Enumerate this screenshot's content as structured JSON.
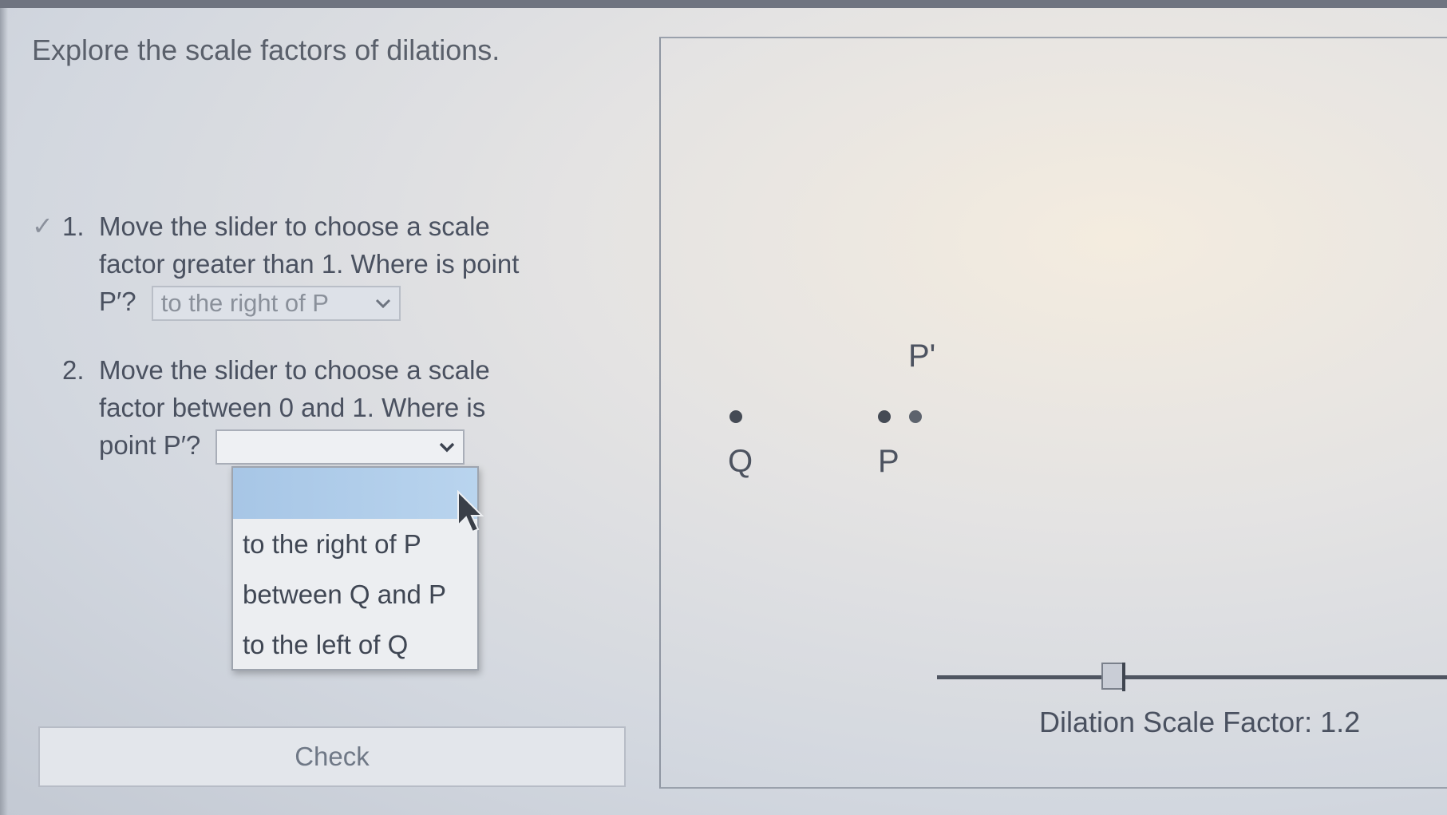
{
  "page": {
    "title": "Explore the scale factors of dilations."
  },
  "question1": {
    "number": "1.",
    "line1": "Move the slider to choose a scale",
    "line2": "factor greater than 1. Where is point",
    "line3_prefix": "P′?",
    "selected": "to the right of P",
    "status": "correct"
  },
  "question2": {
    "number": "2.",
    "line1": "Move the slider to choose a scale",
    "line2": "factor between 0 and 1. Where is",
    "line3_prefix": "point P′?",
    "selected": "",
    "dropdown_open": true,
    "options": [
      "to the right of P",
      "between Q and P",
      "to the left of Q"
    ]
  },
  "check_button": {
    "label": "Check"
  },
  "graph": {
    "points": {
      "Q": "Q",
      "P": "P",
      "P_prime": "P'"
    },
    "slider": {
      "label": "Dilation Scale Factor:",
      "value": "1.2"
    }
  },
  "colors": {
    "accent_highlight": "#a7c6e6",
    "text": "#4a5160"
  },
  "icons": {
    "checkmark": "checkmark-icon",
    "chevron": "chevron-down-icon",
    "cursor": "mouse-pointer-icon"
  }
}
